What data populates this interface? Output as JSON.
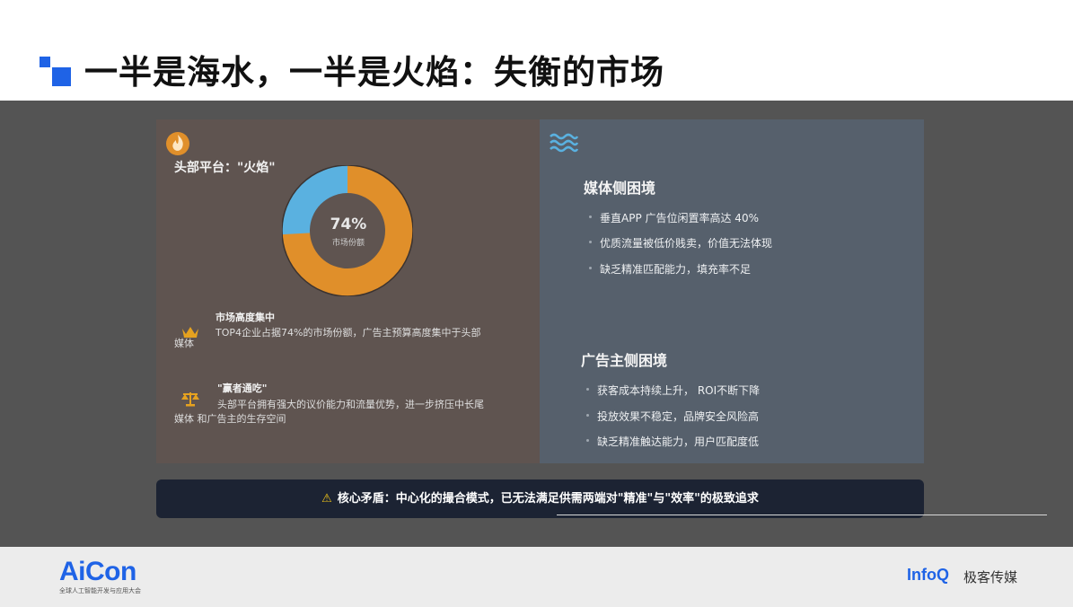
{
  "header": {
    "title": "一半是海水，一半是火焰：失衡的市场"
  },
  "left": {
    "title": "头部平台：\"火焰\"",
    "donut": {
      "percent": "74%",
      "label": "市场份额",
      "share": 74,
      "main_color": "#e08f2a",
      "rest_color": "#5ab1e0"
    },
    "point1": {
      "heading": "市场高度集中",
      "line1": "TOP4企业占据74%的市场份额，广告主预算高度集中于头部",
      "line2": "媒体"
    },
    "point2": {
      "heading": "\"赢者通吃\"",
      "line1": "头部平台拥有强大的议价能力和流量优势，进一步挤压中长尾",
      "line2": "媒体 和广告主的生存空间"
    }
  },
  "right": {
    "media": {
      "heading": "媒体侧困境",
      "items": [
        "垂直APP 广告位闲置率高达  40%",
        "优质流量被低价贱卖，价值无法体现",
        "缺乏精准匹配能力，填充率不足"
      ]
    },
    "advertiser": {
      "heading": "广告主侧困境",
      "items": [
        "获客成本持续上升，  ROI不断下降",
        "投放效果不稳定，品牌安全风险高",
        "缺乏精准触达能力，用户匹配度低"
      ]
    }
  },
  "banner": {
    "icon": "warning-icon",
    "text": "核心矛盾：中心化的撮合模式，已无法满足供需两端对\"精准\"与\"效率\"的极致追求"
  },
  "footer": {
    "brand": "AiCon",
    "brand_sub": "全球人工智能开发与应用大会",
    "partner": "InfoQ",
    "partner_cn": "极客传媒"
  },
  "colors": {
    "accent": "#1f63e6",
    "flame": "#e08f2a",
    "water": "#5ab1e0",
    "banner_bg": "#1c2333"
  }
}
